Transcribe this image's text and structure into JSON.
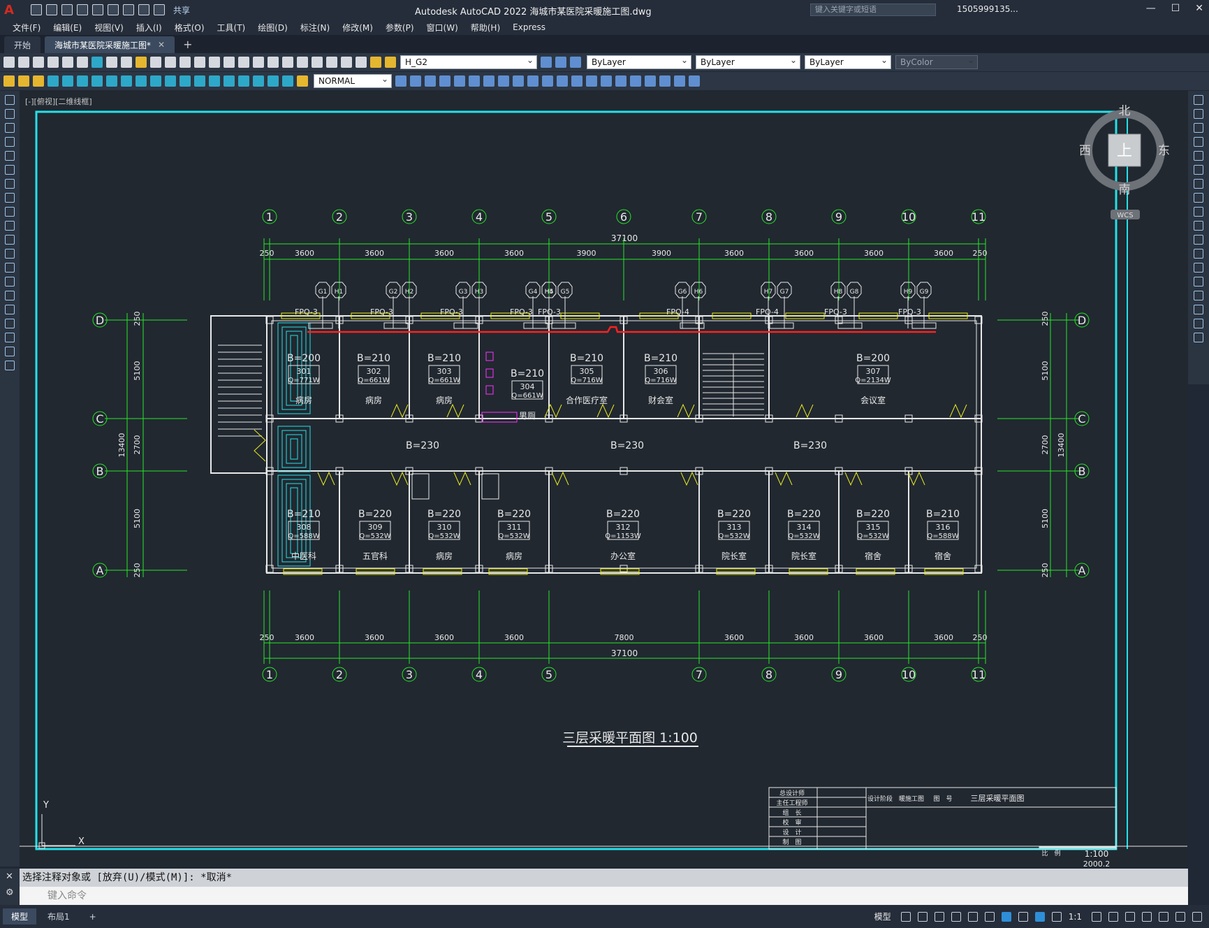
{
  "app": {
    "logo": "A",
    "title": "Autodesk AutoCAD 2022    海城市某医院采暖施工图.dwg",
    "share": "共享",
    "search_placeholder": "键入关键字或短语",
    "user": "1505999135...",
    "window_buttons": [
      "—",
      "☐",
      "✕"
    ]
  },
  "menu": [
    "文件(F)",
    "编辑(E)",
    "视图(V)",
    "插入(I)",
    "格式(O)",
    "工具(T)",
    "绘图(D)",
    "标注(N)",
    "修改(M)",
    "参数(P)",
    "窗口(W)",
    "帮助(H)",
    "Express"
  ],
  "tabs": [
    {
      "label": "开始",
      "active": false
    },
    {
      "label": "海城市某医院采暖施工图*",
      "active": true
    }
  ],
  "toolbar": {
    "layer": "H_G2",
    "color": "ByLayer",
    "linetype": "ByLayer",
    "lineweight": "ByLayer",
    "plotstyle": "ByColor",
    "dimstyle": "NORMAL"
  },
  "viewport_label": "[-][俯视][二维线框]",
  "viewcube": {
    "north": "北",
    "south": "南",
    "west": "西",
    "east": "东",
    "top": "上",
    "wcs": "WCS"
  },
  "drawing": {
    "title": "三层采暖平面图 1:100",
    "total_dim": "37100",
    "top_dims": [
      "250",
      "3600",
      "3600",
      "3600",
      "3600",
      "3900",
      "3900",
      "3600",
      "3600",
      "3600",
      "3600",
      "250"
    ],
    "bottom_dims": [
      "250",
      "3600",
      "3600",
      "3600",
      "3600",
      "7800",
      "3600",
      "3600",
      "3600",
      "3600",
      "250"
    ],
    "axes_top": [
      "1",
      "2",
      "3",
      "4",
      "5",
      "6",
      "7",
      "8",
      "9",
      "10",
      "11"
    ],
    "axes_bottom": [
      "1",
      "2",
      "3",
      "4",
      "5",
      "7",
      "8",
      "9",
      "10",
      "11"
    ],
    "axes_side": [
      "D",
      "C",
      "B",
      "A"
    ],
    "side_dims": [
      "250",
      "5100",
      "2700",
      "5100",
      "250"
    ],
    "side_total": "13400",
    "fpq": [
      "FPQ-3",
      "FPQ-3",
      "FPQ-3",
      "FPQ-3",
      "FPQ-3",
      "FPQ-4",
      "FPQ-4",
      "FPQ-3",
      "FPQ-3"
    ],
    "pipe_tags": [
      "G1",
      "H1",
      "G2",
      "H2",
      "G3",
      "H3",
      "G4",
      "H4",
      "H5",
      "G5",
      "G6",
      "H6",
      "H7",
      "G7",
      "H8",
      "G8",
      "H9",
      "G9"
    ],
    "corridor": "B=230",
    "rooms_top": [
      {
        "b": "B=200",
        "no": "301",
        "q": "Q=771W",
        "name": "病房"
      },
      {
        "b": "B=210",
        "no": "302",
        "q": "Q=661W",
        "name": "病房"
      },
      {
        "b": "B=210",
        "no": "303",
        "q": "Q=661W",
        "name": "病房"
      },
      {
        "b": "B=210",
        "no": "304",
        "q": "Q=661W",
        "name": "男厕"
      },
      {
        "b": "B=210",
        "no": "305",
        "q": "Q=716W",
        "name": "合作医疗室"
      },
      {
        "b": "B=210",
        "no": "306",
        "q": "Q=716W",
        "name": "财会室"
      },
      {
        "b": "B=200",
        "no": "307",
        "q": "Q=2134W",
        "name": "会议室"
      }
    ],
    "rooms_bottom": [
      {
        "b": "B=210",
        "no": "308",
        "q": "Q=588W",
        "name": "中医科"
      },
      {
        "b": "B=220",
        "no": "309",
        "q": "Q=532W",
        "name": "五官科"
      },
      {
        "b": "B=220",
        "no": "310",
        "q": "Q=532W",
        "name": "病房"
      },
      {
        "b": "B=220",
        "no": "311",
        "q": "Q=532W",
        "name": "病房"
      },
      {
        "b": "B=220",
        "no": "312",
        "q": "Q=1153W",
        "name": "办公室"
      },
      {
        "b": "B=220",
        "no": "313",
        "q": "Q=532W",
        "name": "院长室"
      },
      {
        "b": "B=220",
        "no": "314",
        "q": "Q=532W",
        "name": "院长室"
      },
      {
        "b": "B=220",
        "no": "315",
        "q": "Q=532W",
        "name": "宿舍"
      },
      {
        "b": "B=210",
        "no": "316",
        "q": "Q=588W",
        "name": "宿舍"
      }
    ],
    "titleblock": {
      "rows": [
        "总设计师",
        "主任工程师",
        "组　长",
        "校　审",
        "设　计",
        "制　图"
      ],
      "stage_label": "设计阶段",
      "stage": "暖施工图",
      "no_label": "图　号",
      "drawing_name": "三层采暖平面图",
      "scale_label": "比　例",
      "scale": "1:100",
      "date": "2000.2"
    },
    "ucs": {
      "x": "X",
      "y": "Y"
    }
  },
  "command": {
    "history": "选择注释对象或 [放弃(U)/模式(M)]: *取消*",
    "placeholder": "键入命令"
  },
  "status": {
    "tabs": [
      "模型",
      "布局1"
    ],
    "model": "模型",
    "scale": "1:1"
  }
}
